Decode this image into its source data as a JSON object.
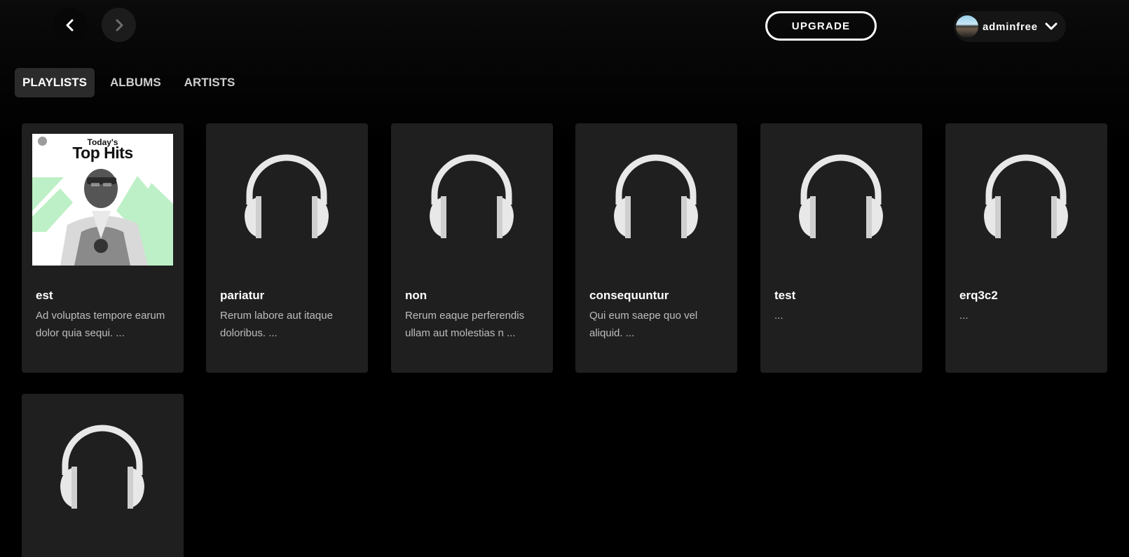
{
  "topbar": {
    "back_icon": "chevron-left-icon",
    "forward_icon": "chevron-right-icon",
    "upgrade_label": "UPGRADE",
    "user": {
      "name": "adminfree",
      "menu_icon": "chevron-down-icon"
    }
  },
  "tabs": [
    {
      "label": "PLAYLISTS",
      "active": true
    },
    {
      "label": "ALBUMS",
      "active": false
    },
    {
      "label": "ARTISTS",
      "active": false
    }
  ],
  "playlists": [
    {
      "title": "est",
      "description": "Ad voluptas tempore earum dolor quia sequi. ...",
      "cover": "image",
      "cover_text_small": "Today's",
      "cover_text_big": "Top Hits"
    },
    {
      "title": "pariatur",
      "description": "Rerum labore aut itaque doloribus. ...",
      "cover": "headphones-icon"
    },
    {
      "title": "non",
      "description": "Rerum eaque perferendis ullam aut molestias n ...",
      "cover": "headphones-icon"
    },
    {
      "title": "consequuntur",
      "description": "Qui eum saepe quo vel aliquid. ...",
      "cover": "headphones-icon"
    },
    {
      "title": "test",
      "description": "...",
      "cover": "headphones-icon"
    },
    {
      "title": "erq3c2",
      "description": "...",
      "cover": "headphones-icon"
    },
    {
      "title": "",
      "description": "",
      "cover": "headphones-icon"
    }
  ],
  "colors": {
    "background": "#000000",
    "card": "#1f1f1f",
    "tab_active": "#2b2b2b",
    "accent_green": "#bdf0c6"
  }
}
